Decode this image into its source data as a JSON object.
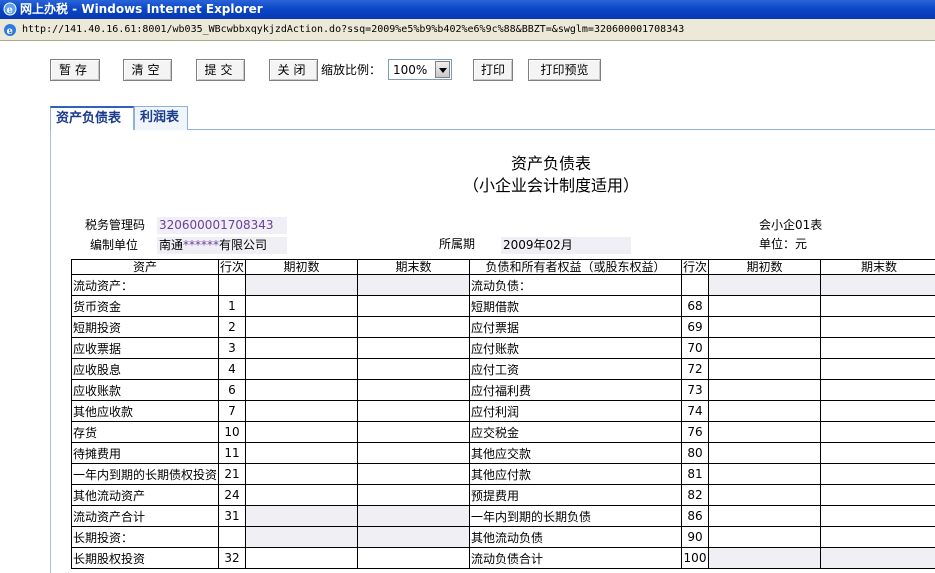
{
  "window": {
    "title": "网上办税 - Windows Internet Explorer",
    "url": "http://141.40.16.61:8001/wb035_WBcwbbxqykjzdAction.do?ssq=2009%e5%b9%b402%e6%9c%88&BBZT=&swglm=320600001708343"
  },
  "toolbar": {
    "save": "暂存",
    "clear": "清空",
    "submit": "提交",
    "close": "关闭",
    "zoom_label": "缩放比例：",
    "zoom_value": "100%",
    "print": "打印",
    "print_preview": "打印预览"
  },
  "tabs": [
    {
      "label": "资产负债表",
      "active": true
    },
    {
      "label": "利润表",
      "active": false
    }
  ],
  "report": {
    "title": "资产负债表",
    "subtitle": "（小企业会计制度适用）",
    "tax_code_label": "税务管理码",
    "tax_code_value": "320600001708343",
    "unit_label": "编制单位",
    "unit_value_prefix": "南通",
    "unit_value_mask": "******",
    "unit_value_suffix": "有限公司",
    "period_label": "所属期",
    "period_value": "2009年02月",
    "form_code": "会小企01表",
    "currency_unit": "单位：元"
  },
  "table": {
    "headers": [
      "资产",
      "行次",
      "期初数",
      "期末数",
      "负债和所有者权益（或股东权益）",
      "行次",
      "期初数",
      "期末数"
    ],
    "rows": [
      {
        "left": "流动资产：",
        "left_no": "",
        "left_gray": true,
        "right": "流动负债：",
        "right_no": "",
        "right_gray": true
      },
      {
        "left": "货币资金",
        "left_no": "1",
        "left_gray": false,
        "right": "短期借款",
        "right_no": "68",
        "right_gray": false
      },
      {
        "left": "短期投资",
        "left_no": "2",
        "left_gray": false,
        "right": "应付票据",
        "right_no": "69",
        "right_gray": false
      },
      {
        "left": "应收票据",
        "left_no": "3",
        "left_gray": false,
        "right": "应付账款",
        "right_no": "70",
        "right_gray": false
      },
      {
        "left": "应收股息",
        "left_no": "4",
        "left_gray": false,
        "right": "应付工资",
        "right_no": "72",
        "right_gray": false
      },
      {
        "left": "应收账款",
        "left_no": "6",
        "left_gray": false,
        "right": "应付福利费",
        "right_no": "73",
        "right_gray": false
      },
      {
        "left": "其他应收款",
        "left_no": "7",
        "left_gray": false,
        "right": "应付利润",
        "right_no": "74",
        "right_gray": false
      },
      {
        "left": "存货",
        "left_no": "10",
        "left_gray": false,
        "right": "应交税金",
        "right_no": "76",
        "right_gray": false
      },
      {
        "left": "待摊费用",
        "left_no": "11",
        "left_gray": false,
        "right": "其他应交款",
        "right_no": "80",
        "right_gray": false
      },
      {
        "left": "一年内到期的长期债权投资",
        "left_no": "21",
        "left_gray": false,
        "right": "其他应付款",
        "right_no": "81",
        "right_gray": false
      },
      {
        "left": "其他流动资产",
        "left_no": "24",
        "left_gray": false,
        "right": "预提费用",
        "right_no": "82",
        "right_gray": false
      },
      {
        "left": "流动资产合计",
        "left_no": "31",
        "left_gray": true,
        "right": "一年内到期的长期负债",
        "right_no": "86",
        "right_gray": false
      },
      {
        "left": "长期投资：",
        "left_no": "",
        "left_gray": true,
        "right": "其他流动负债",
        "right_no": "90",
        "right_gray": false
      },
      {
        "left": "长期股权投资",
        "left_no": "32",
        "left_gray": false,
        "right": "流动负债合计",
        "right_no": "100",
        "right_gray": true
      }
    ]
  }
}
